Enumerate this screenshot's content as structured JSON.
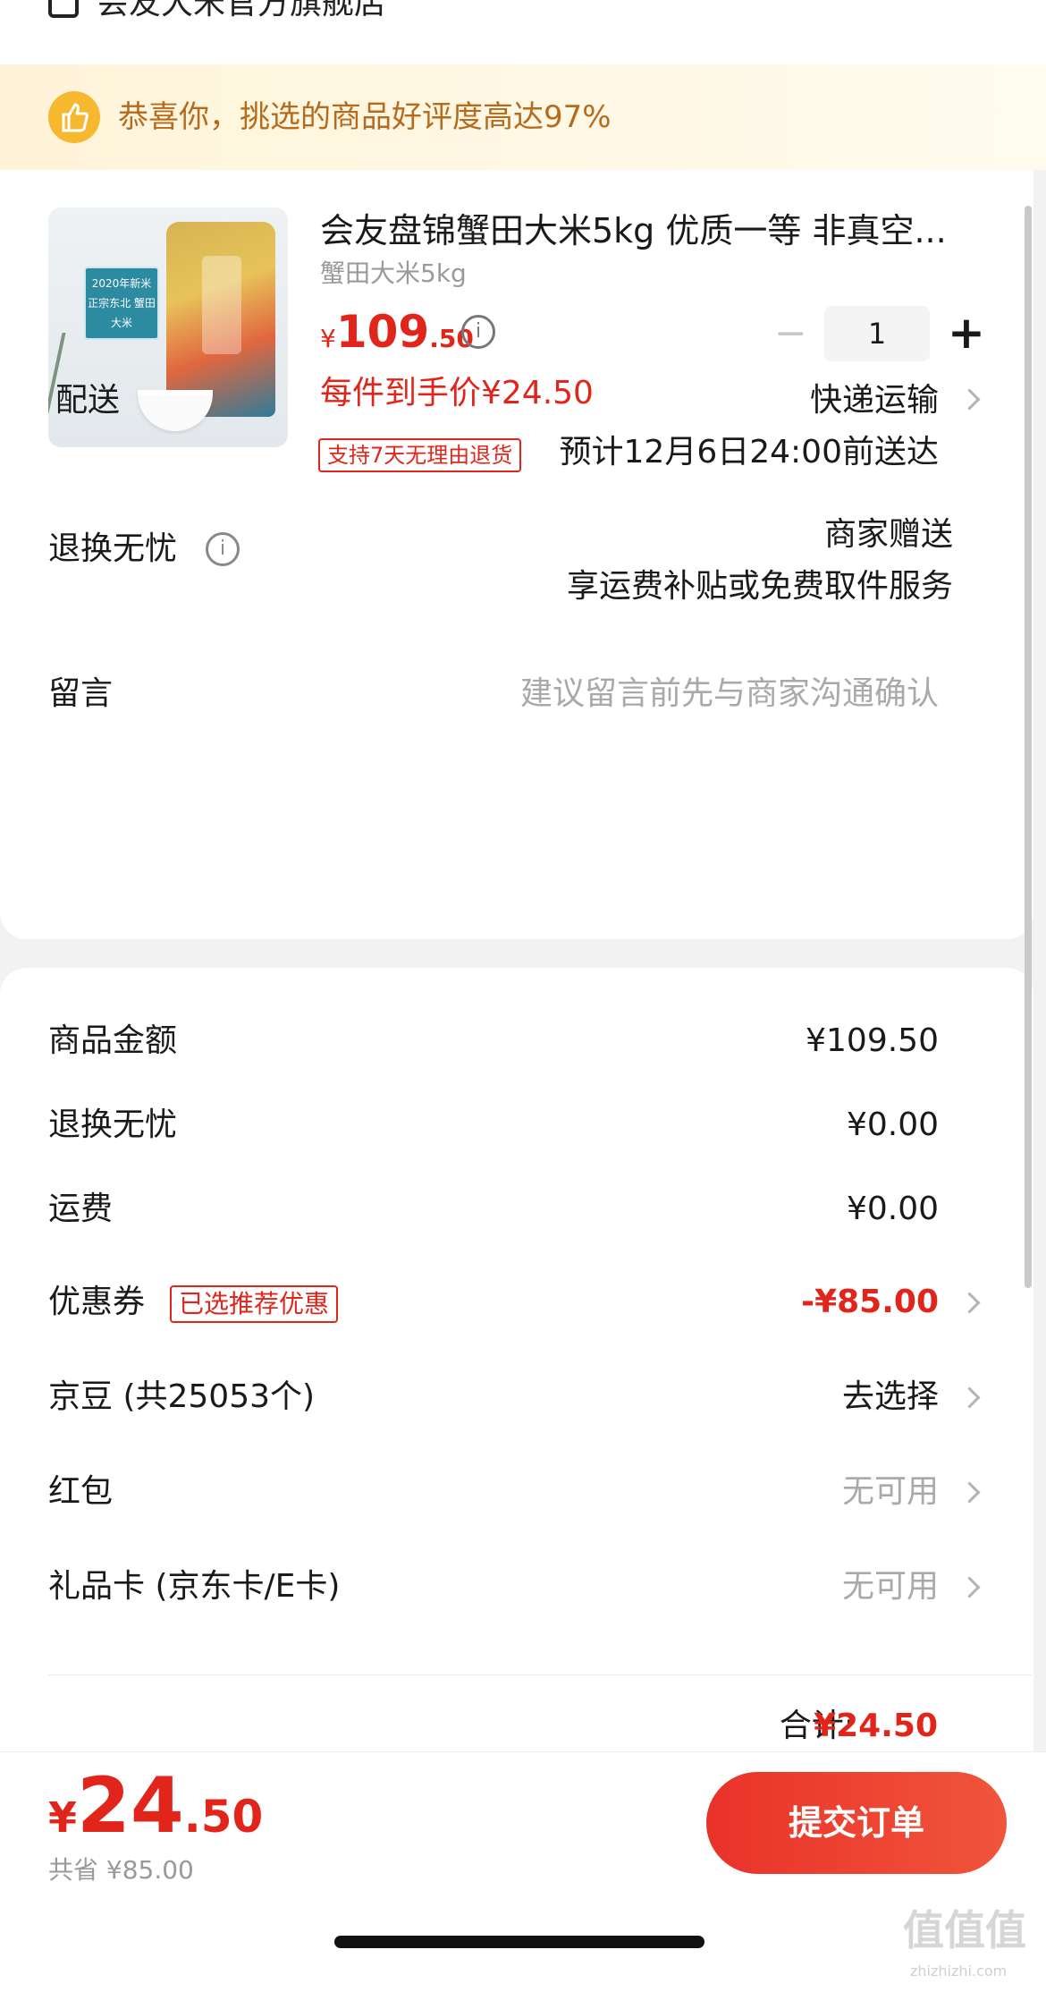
{
  "store": {
    "name": "会友大米官方旗舰店",
    "icon": "store-icon"
  },
  "banner": {
    "icon": "thumbs-up-icon",
    "text": "恭喜你，挑选的商品好评度高达97%"
  },
  "product": {
    "title": "会友盘锦蟹田大米5kg 优质一等 非真空...",
    "spec": "蟹田大米5kg",
    "price_currency": "¥",
    "price_int": "109",
    "price_dec": ".50",
    "quantity": "1",
    "each_price": "每件到手价¥24.50",
    "return_tag": "支持7天无理由退货",
    "image_label": "2020年新米 正宗东北 蟹田大米"
  },
  "delivery": {
    "label": "配送",
    "method": "快递运输",
    "eta": "预计12月6日24:00前送达"
  },
  "worry_free": {
    "label": "退换无忧",
    "value": "商家赠送",
    "desc": "享运费补贴或免费取件服务"
  },
  "message": {
    "label": "留言",
    "placeholder": "建议留言前先与商家沟通确认"
  },
  "summary": {
    "goods_label": "商品金额",
    "goods_value": "¥109.50",
    "worry_label": "退换无忧",
    "worry_value": "¥0.00",
    "freight_label": "运费",
    "freight_value": "¥0.00",
    "coupon_label": "优惠券",
    "coupon_tag": "已选推荐优惠",
    "coupon_value": "-¥85.00",
    "beans_label": "京豆 (共25053个)",
    "beans_value": "去选择",
    "redpacket_label": "红包",
    "redpacket_value": "无可用",
    "giftcard_label": "礼品卡 (京东卡/E卡)",
    "giftcard_value": "无可用",
    "total_label": "合计:",
    "total_value": "¥24.50"
  },
  "bottom": {
    "pay_currency": "¥",
    "pay_int": "24",
    "pay_dec": ".50",
    "saved": "共省 ¥85.00",
    "submit": "提交订单"
  },
  "watermark": {
    "text": "值值值",
    "url": "zhizhizhi.com"
  },
  "colors": {
    "accent_red": "#e1251b",
    "banner_text": "#b66a1c",
    "banner_bg": "#fff4d9"
  }
}
